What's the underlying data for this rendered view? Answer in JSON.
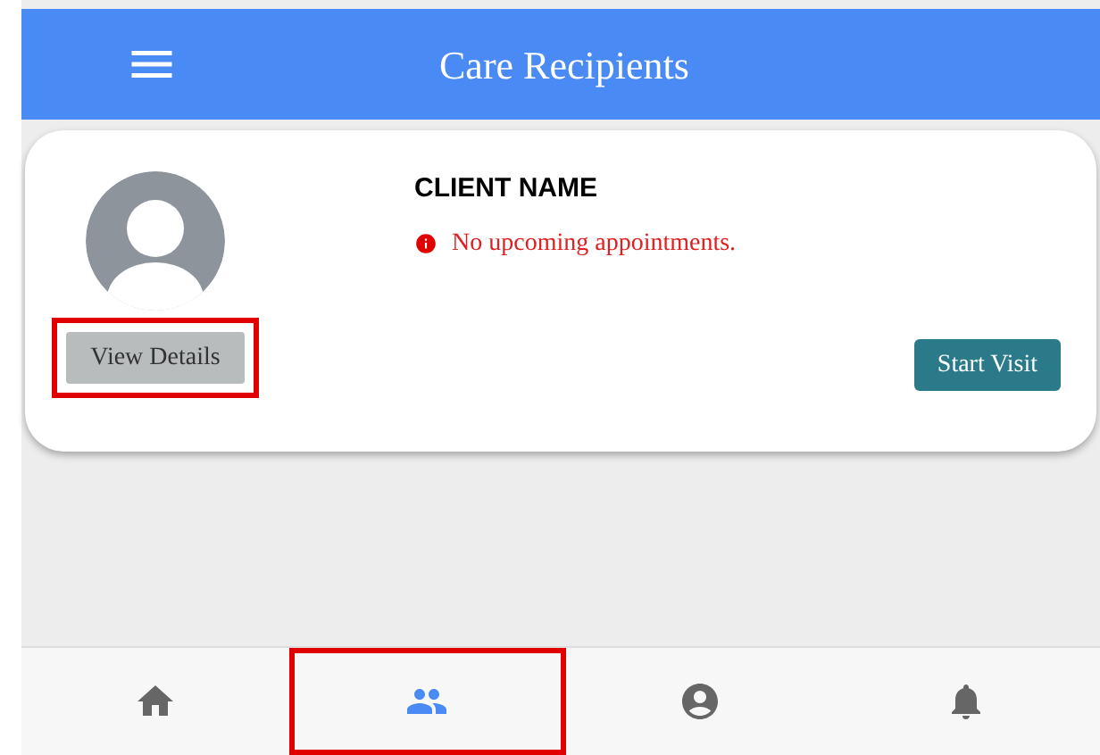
{
  "header": {
    "title": "Care Recipients"
  },
  "client_card": {
    "name": "CLIENT NAME",
    "notice": "No upcoming appointments.",
    "view_button": {
      "label": "View Details",
      "highlighted": true
    },
    "start_button": {
      "label": "Start Visit"
    }
  },
  "bottom_nav": [
    {
      "kind": "home",
      "selected": false,
      "highlighted": false
    },
    {
      "kind": "people",
      "selected": true,
      "highlighted": true
    },
    {
      "kind": "account",
      "selected": false,
      "highlighted": false
    },
    {
      "kind": "bell",
      "selected": false,
      "highlighted": false
    }
  ]
}
